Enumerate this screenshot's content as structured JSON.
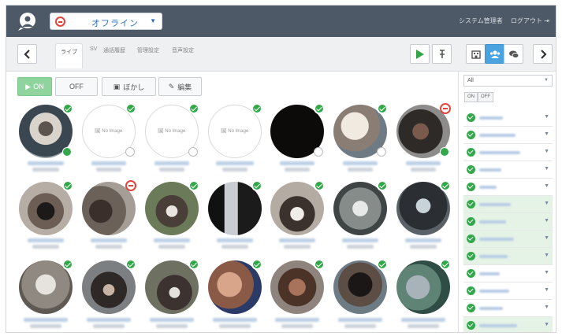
{
  "header": {
    "status_label": "オフライン",
    "admin_label": "システム管理者",
    "logout_label": "ログアウト"
  },
  "tabs": [
    "ライブ",
    "SV",
    "通話履歴",
    "管理設定",
    "音声設定"
  ],
  "controls": {
    "on_label": "ON",
    "off_label": "OFF",
    "blur_label": "ぼかし",
    "edit_label": "編集"
  },
  "no_image_label": "No Image",
  "sidebar": {
    "filter_value": "All",
    "btn1": "ON",
    "btn2": "OFF",
    "row_count": 15
  },
  "colors": {
    "topbar": "#4d5966",
    "online": "#32a84b",
    "offline": "#e0443e",
    "accent": "#2f6fbf"
  }
}
